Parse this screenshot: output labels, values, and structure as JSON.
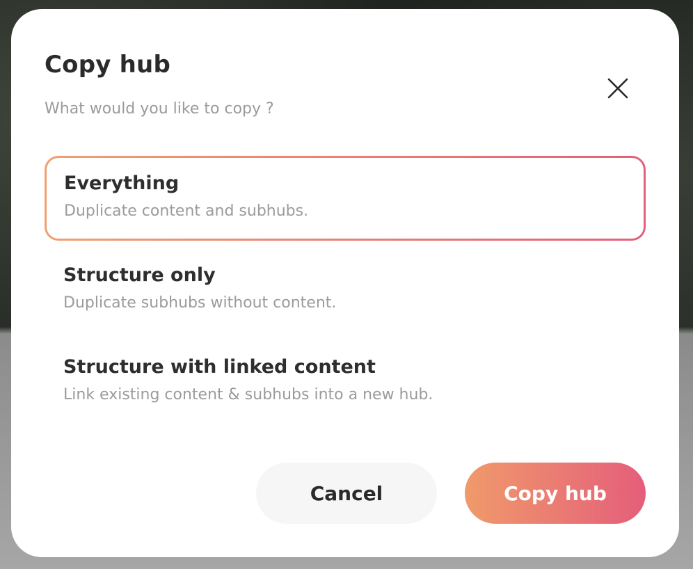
{
  "dialog": {
    "title": "Copy hub",
    "subtitle": "What would you like to copy ?",
    "close_icon": "close-icon"
  },
  "options": [
    {
      "title": "Everything",
      "description": "Duplicate content and subhubs.",
      "selected": true
    },
    {
      "title": "Structure only",
      "description": "Duplicate subhubs without content.",
      "selected": false
    },
    {
      "title": "Structure with linked content",
      "description": "Link existing content & subhubs into a new hub.",
      "selected": false
    }
  ],
  "actions": {
    "cancel_label": "Cancel",
    "confirm_label": "Copy hub"
  },
  "colors": {
    "accent_start": "#f09a6b",
    "accent_end": "#e45e7a",
    "title_text": "#2b2b2b",
    "muted_text": "#9a9a9a"
  }
}
